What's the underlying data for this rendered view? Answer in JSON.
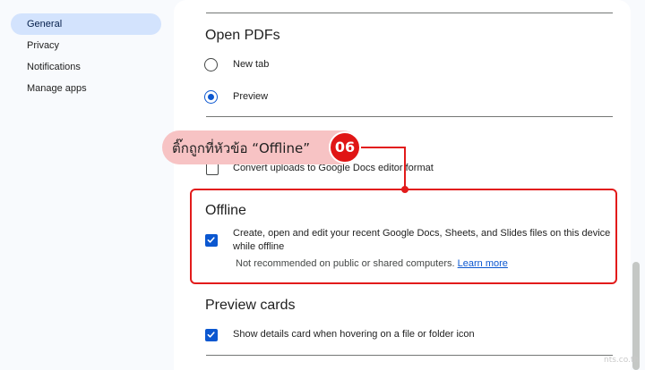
{
  "sidebar": {
    "items": [
      {
        "label": "General",
        "active": true
      },
      {
        "label": "Privacy",
        "active": false
      },
      {
        "label": "Notifications",
        "active": false
      },
      {
        "label": "Manage apps",
        "active": false
      }
    ]
  },
  "open_pdfs": {
    "title": "Open PDFs",
    "options": [
      {
        "label": "New tab",
        "selected": false
      },
      {
        "label": "Preview",
        "selected": true
      }
    ]
  },
  "convert": {
    "label": "Convert uploads to Google Docs editor format",
    "checked": false
  },
  "offline": {
    "title": "Offline",
    "checked": true,
    "description_line1": "Create, open and edit your recent Google Docs, Sheets, and Slides files on this device",
    "description_line2": "while offline",
    "note": "Not recommended on public or shared computers.",
    "link": "Learn more"
  },
  "preview_cards": {
    "title": "Preview cards",
    "label": "Show details card when hovering on a file or folder icon",
    "checked": true
  },
  "annotation": {
    "text": "ติ๊กถูกที่หัวข้อ “Offline”",
    "step": "06"
  },
  "watermark": "nts.co.th",
  "colors": {
    "accent": "#0b57d0",
    "highlight": "#e21b1b",
    "callout_bg": "#f7c3c4",
    "nav_active": "#d3e3fd"
  }
}
